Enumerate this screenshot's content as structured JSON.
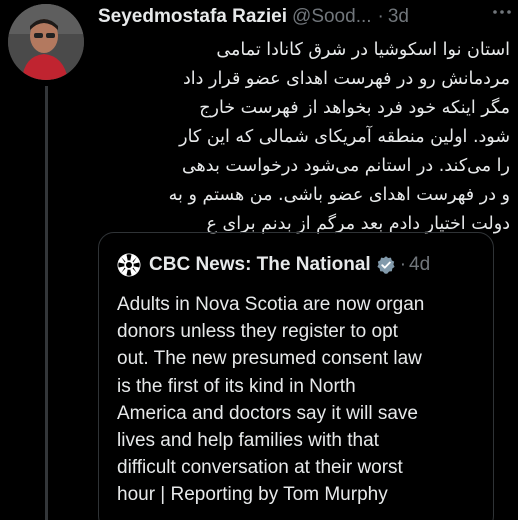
{
  "tweet": {
    "author_name": "Seyedmostafa Raziei",
    "author_handle": "@Sood...",
    "separator": "·",
    "time": "3d",
    "more_icon": "more-horizontal-icon",
    "body_lines": [
      "استان نوا اسکوشیا در شرق کانادا تمامی",
      "مردمانش رو در فهرست اهدای عضو قرار داد",
      "مگر اینکه خود فرد بخواهد از فهرست خارج",
      "شود. اولین منطقه آمریکای شمالی که این کار",
      "را می‌کند. در استانم می‌شود درخواست بدهی",
      "و در فهرست اهدای عضو باشی. من هستم و به",
      "دولت اختیار دادم بعد مرگم از بدنم برای ع"
    ]
  },
  "quoted_tweet": {
    "logo_icon": "cbc-gem-logo-icon",
    "author_name": "CBC News: The National",
    "verified_icon": "verified-badge-icon",
    "separator": "·",
    "time": "4d",
    "text_lines": [
      "Adults in Nova Scotia are now organ",
      "donors unless they register to opt",
      "out. The new presumed consent law",
      "is the first of its kind in North",
      "America and doctors say it will save",
      "lives and help families with that",
      "difficult conversation at their worst",
      "hour | Reporting by Tom Murphy"
    ]
  },
  "colors": {
    "background": "#000000",
    "primary_text": "#e7e9ea",
    "secondary_text": "#71767b",
    "border": "#2f3336"
  }
}
